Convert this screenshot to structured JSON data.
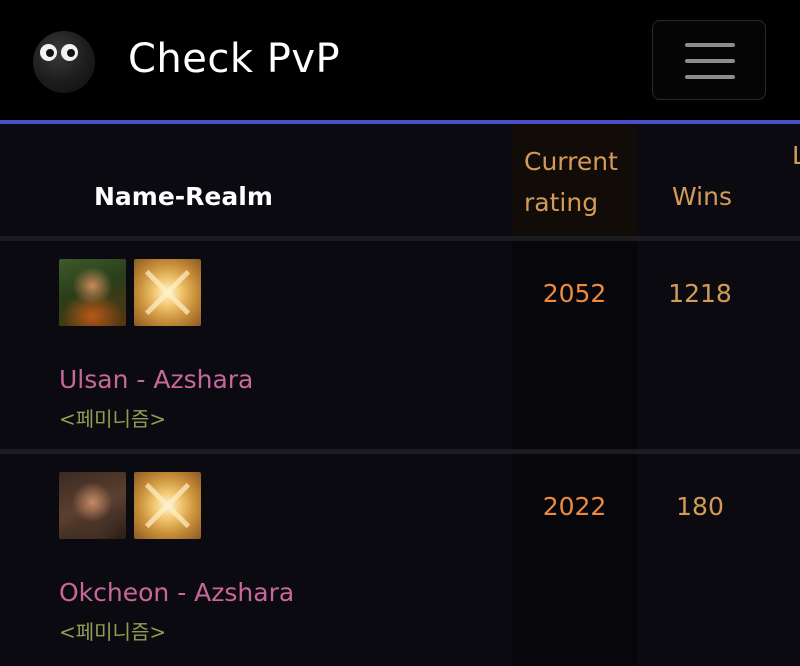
{
  "navbar": {
    "brand": "Check PvP",
    "logo_icon": "googly-eyes-logo-icon",
    "menu_icon": "hamburger-menu-icon",
    "accent_color": "#4a4fc9"
  },
  "table": {
    "headers": {
      "name_realm": "Name-Realm",
      "current_rating": "Current rating",
      "wins": "Wins",
      "next_cut": "L"
    },
    "highlight_color": "#e1a456",
    "rows": [
      {
        "name": "Ulsan - Azshara",
        "guild": "<페미니즘>",
        "rating": "2052",
        "wins": "1218",
        "race_icon": "dwarf-portrait-icon",
        "spec_icon": "holy-light-spec-icon"
      },
      {
        "name": "Okcheon - Azshara",
        "guild": "<페미니즘>",
        "rating": "2022",
        "wins": "180",
        "race_icon": "human-portrait-icon",
        "spec_icon": "holy-light-spec-icon"
      }
    ]
  }
}
